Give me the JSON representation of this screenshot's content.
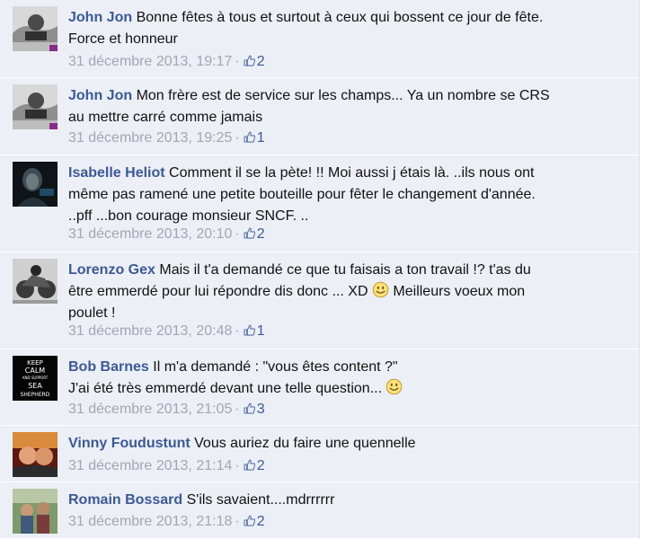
{
  "comments": [
    {
      "author": "John Jon",
      "text_line1": "Bonne fêtes à tous et surtout à ceux qui bossent ce jour de fête.",
      "text_line2": "Force et honneur",
      "timestamp": "31 décembre 2013, 19:17",
      "likes": "2",
      "avatar": "avatar-john-jon"
    },
    {
      "author": "John Jon",
      "text_line1": "Mon frère est de service sur les champs... Ya un nombre se CRS",
      "text_line2": "au mettre carré comme jamais",
      "timestamp": "31 décembre 2013, 19:25",
      "likes": "1",
      "avatar": "avatar-john-jon"
    },
    {
      "author": "Isabelle Heliot",
      "text_line1": "Comment il se la pète! !! Moi aussi j étais là. ..ils nous ont",
      "text_line2": "même pas ramené une petite bouteille pour fêter le changement d'année.",
      "text_line3": "..pff ...bon courage monsieur SNCF. ..",
      "timestamp": "31 décembre 2013, 20:10",
      "likes": "2",
      "avatar": "avatar-isabelle-heliot"
    },
    {
      "author": "Lorenzo Gex",
      "text_line1": "Mais il t'a demandé ce que tu faisais a ton travail !? t'as du",
      "text_line2a": "être emmerdé pour lui répondre dis donc ... XD",
      "text_line2b": "Meilleurs voeux mon",
      "text_line3": "poulet !",
      "timestamp": "31 décembre 2013, 20:48",
      "likes": "1",
      "avatar": "avatar-lorenzo-gex"
    },
    {
      "author": "Bob Barnes",
      "text_line1": "Il m'a demandé : \"vous êtes content ?\"",
      "text_line2": "J'ai été très emmerdé devant une telle question...",
      "timestamp": "31 décembre 2013, 21:05",
      "likes": "3",
      "avatar": "avatar-bob-barnes",
      "avatar_text": [
        "KEEP",
        "CALM",
        "AND SUPPORT",
        "SEA",
        "SHEPHERD"
      ]
    },
    {
      "author": "Vinny Foudustunt",
      "text_line1": "Vous auriez du faire une quennelle",
      "timestamp": "31 décembre 2013, 21:14",
      "likes": "2",
      "avatar": "avatar-vinny-foudustunt"
    },
    {
      "author": "Romain Bossard",
      "text_line1": "S'ils savaient....mdrrrrrr",
      "timestamp": "31 décembre 2013, 21:18",
      "likes": "2",
      "avatar": "avatar-romain-bossard"
    }
  ],
  "colors": {
    "background": "#eceff5",
    "author": "#3b5998",
    "meta": "#a1a7b4",
    "text": "#111111"
  },
  "icons": {
    "like": "thumbs-up-icon",
    "emoticon": "smiley-icon",
    "separator": "·"
  }
}
